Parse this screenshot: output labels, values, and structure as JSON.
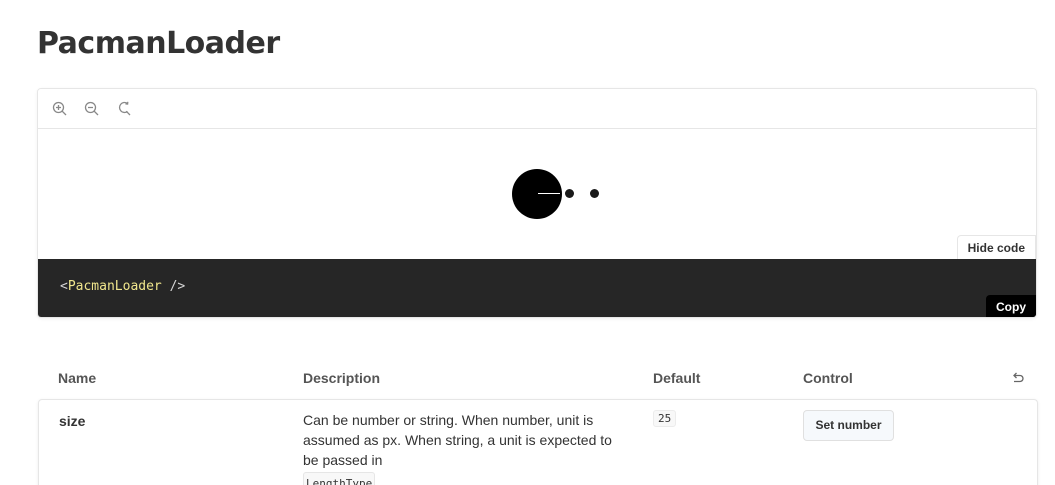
{
  "page": {
    "title": "PacmanLoader"
  },
  "toolbar": {
    "zoom_in": "zoom-in-icon",
    "zoom_out": "zoom-out-icon",
    "reset_zoom": "reset-zoom-icon"
  },
  "preview": {
    "code": "<PacmanLoader />",
    "component_name": "PacmanLoader",
    "hide_code_label": "Hide code",
    "copy_label": "Copy",
    "colors": {
      "loader": "#000000",
      "code_bg": "#262626",
      "tag_color": "#f0e68c"
    }
  },
  "props_table": {
    "headers": [
      "Name",
      "Description",
      "Default",
      "Control"
    ],
    "reset_icon": "undo-icon",
    "rows": [
      {
        "name": "size",
        "description": "Can be number or string. When number, unit is assumed as px. When string, a unit is expected to be passed in",
        "type": "LengthType",
        "default": "25",
        "control_label": "Set number"
      }
    ]
  }
}
